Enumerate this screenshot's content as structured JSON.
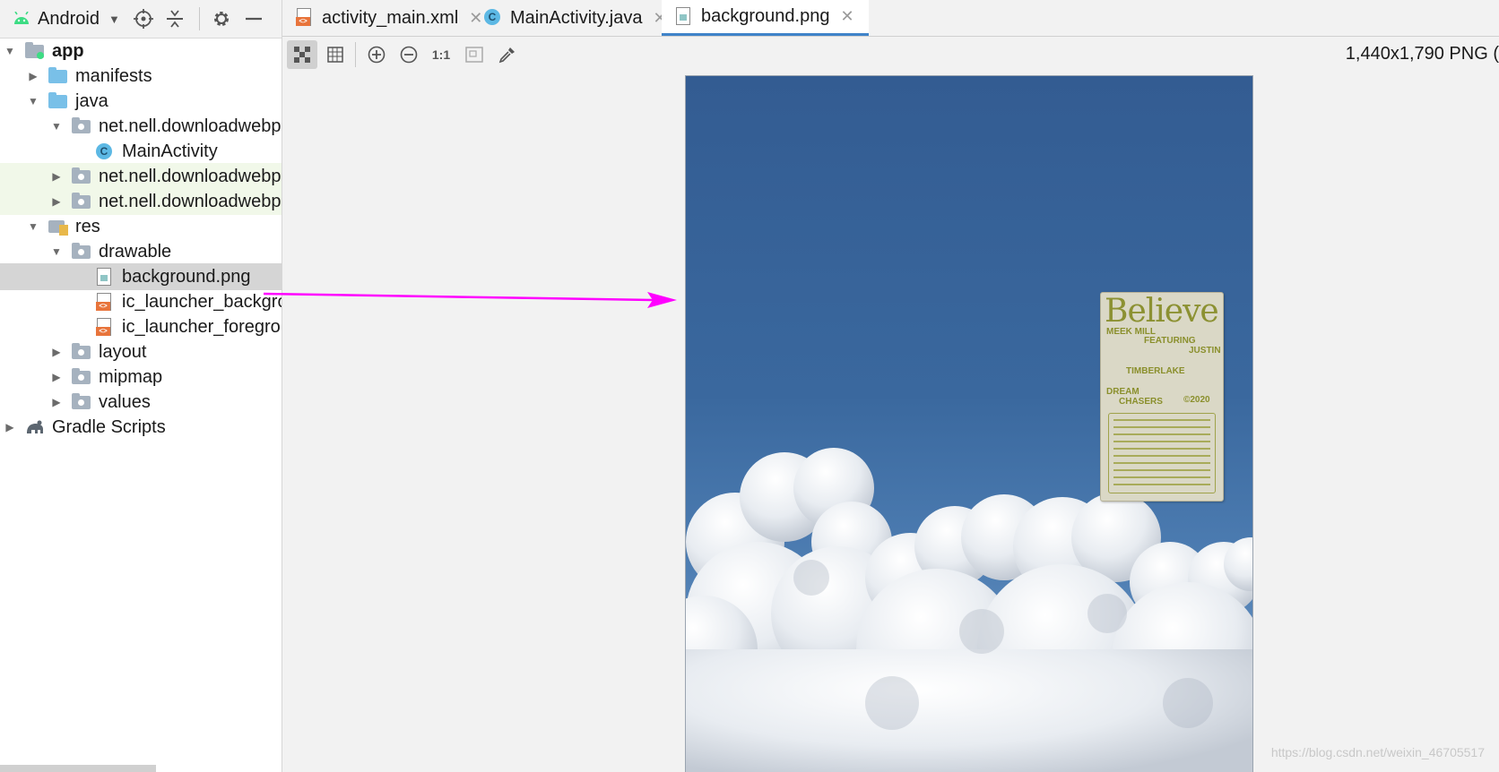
{
  "sidebar": {
    "view_selector": "Android",
    "tree": [
      {
        "label": "app"
      },
      {
        "label": "manifests"
      },
      {
        "label": "java"
      },
      {
        "label": "net.nell.downloadwebp"
      },
      {
        "label": "MainActivity"
      },
      {
        "label": "net.nell.downloadwebp"
      },
      {
        "label": "net.nell.downloadwebp"
      },
      {
        "label": "res"
      },
      {
        "label": "drawable"
      },
      {
        "label": "background.png"
      },
      {
        "label": "ic_launcher_backgro"
      },
      {
        "label": "ic_launcher_foregrou"
      },
      {
        "label": "layout"
      },
      {
        "label": "mipmap"
      },
      {
        "label": "values"
      },
      {
        "label": "Gradle Scripts"
      }
    ]
  },
  "tabs": [
    {
      "label": "activity_main.xml"
    },
    {
      "label": "MainActivity.java"
    },
    {
      "label": "background.png"
    }
  ],
  "image_toolbar": {
    "actual_size_label": "1:1",
    "info": "1,440x1,790 PNG ("
  },
  "image": {
    "label_title": "Believe",
    "label_lines": [
      "MEEK MILL",
      "FEATURING",
      "JUSTIN",
      "TIMBERLAKE",
      "DREAM",
      "CHASERS",
      "©2020"
    ]
  },
  "watermark": "https://blog.csdn.net/weixin_46705517",
  "colors": {
    "accent": "#4083c9",
    "selection": "#d5d5d5",
    "annotation_arrow": "#ff00ff"
  }
}
